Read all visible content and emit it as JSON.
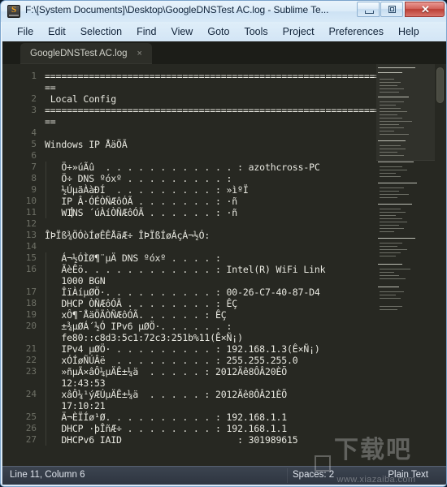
{
  "window": {
    "title": "F:\\[System Documents]\\Desktop\\GoogleDNSTest AC.log - Sublime Te...",
    "app_icon": "sublime-text-icon",
    "minimize_label": "–",
    "maximize_label": "❐",
    "close_label": "✕"
  },
  "menubar": {
    "items": [
      {
        "label": "File"
      },
      {
        "label": "Edit"
      },
      {
        "label": "Selection"
      },
      {
        "label": "Find"
      },
      {
        "label": "View"
      },
      {
        "label": "Goto"
      },
      {
        "label": "Tools"
      },
      {
        "label": "Project"
      },
      {
        "label": "Preferences"
      },
      {
        "label": "Help"
      }
    ]
  },
  "tabs": [
    {
      "label": "GoogleDNSTest AC.log",
      "close_glyph": "×",
      "active": true
    }
  ],
  "editor": {
    "background_color": "#272822",
    "foreground_color": "#e8e8e0",
    "gutter_color": "#6e7066",
    "active_line": 11,
    "caret_line": 11,
    "caret_column": 6,
    "lines": [
      {
        "num": "1",
        "text": "============================================================="
      },
      {
        "num": "",
        "text": "=="
      },
      {
        "num": "2",
        "text": " Local Config"
      },
      {
        "num": "3",
        "text": "============================================================="
      },
      {
        "num": "",
        "text": "=="
      },
      {
        "num": "4",
        "text": ""
      },
      {
        "num": "5",
        "text": "Windows IP ÅäÖÃ"
      },
      {
        "num": "6",
        "text": ""
      },
      {
        "num": "7",
        "text": "   Ö÷»úÃû  . . . . . . . . . . . . : azothcross-PC"
      },
      {
        "num": "8",
        "text": "   Ö÷ DNS ºóxº . . . . . . . . . :"
      },
      {
        "num": "9",
        "text": "   ½ÚµãÀàÐÍ  . . . . . . . . . : »ìºÏ"
      },
      {
        "num": "10",
        "text": "   IP Â·ÓÉÒÑÆôÓÃ . . . . . . . : ·ñ"
      },
      {
        "num": "11",
        "text": "   WINS ´úÀíÒÑÆôÓÃ . . . . . . : ·ñ"
      },
      {
        "num": "12",
        "text": ""
      },
      {
        "num": "13",
        "text": "ÎÞÏß¾ÖÓòÍøÊÊÅäÆ÷ ÎÞÏßÍøÂçÁ¬½Ó:"
      },
      {
        "num": "14",
        "text": ""
      },
      {
        "num": "15",
        "text": "   Á¬½ÓÌØ¶¨µÄ DNS ºóxº . . . . :"
      },
      {
        "num": "16",
        "text": "   ÃèÊö. . . . . . . . . . . . : Intel(R) WiFi Link"
      },
      {
        "num": "",
        "text": "   1000 BGN"
      },
      {
        "num": "17",
        "text": "   ÎïÀíµØÖ·. . . . . . . . . . : 00-26-C7-40-87-D4"
      },
      {
        "num": "18",
        "text": "   DHCP ÒÑÆôÓÃ . . . . . . . . : ÊÇ"
      },
      {
        "num": "19",
        "text": "   xÔ¶¯ÅäÖÃÒÑÆôÓÃ. . . . . . : ÊÇ"
      },
      {
        "num": "20",
        "text": "   ±¾µØÁ´½Ó IPv6 µØÖ·. . . . . . :"
      },
      {
        "num": "",
        "text": "   fe80::c8d3:5c1:72c3:251b%11(Ê×Ñ¡)"
      },
      {
        "num": "21",
        "text": "   IPv4 µØÖ· . . . . . . . . . : 192.168.1.3(Ê×Ñ¡)"
      },
      {
        "num": "22",
        "text": "   xÓÍøÑÚÂë  . . . . . . . . . : 255.255.255.0"
      },
      {
        "num": "23",
        "text": "   »ñµÃ×âÔ¼µÄÊ±¼ä  . . . . . : 2012Äê8ÔÂ20ÈÕ"
      },
      {
        "num": "",
        "text": "   12:43:53"
      },
      {
        "num": "24",
        "text": "   xâÔ¼¹ýÆÚµÄÊ±¼ä  . . . . . : 2012Äê8ÔÂ21ÈÕ"
      },
      {
        "num": "",
        "text": "   17:10:21"
      },
      {
        "num": "25",
        "text": "   Ä¬ÈÏÍø¹Ø. . . . . . . . . . : 192.168.1.1"
      },
      {
        "num": "26",
        "text": "   DHCP ·þÎñÆ÷ . . . . . . . . : 192.168.1.1"
      },
      {
        "num": "27",
        "text": "   DHCPv6 IAID                     : 301989615"
      }
    ]
  },
  "statusbar": {
    "cursor_position": "Line 11, Column 6",
    "indentation": "Spaces: 2",
    "syntax": "Plain Text"
  },
  "watermark": {
    "cjk": "下载吧",
    "url": "www.xiazaiba.com"
  }
}
